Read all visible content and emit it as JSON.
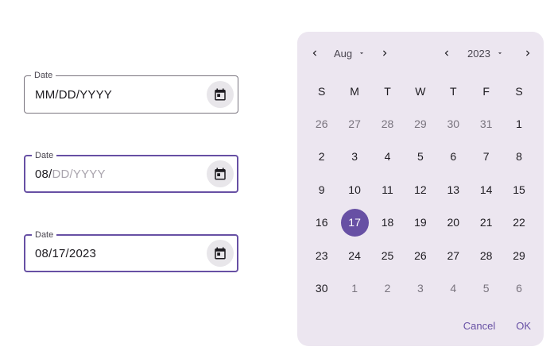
{
  "fields": [
    {
      "label": "Date",
      "typed": "",
      "hint": "MM/DD/YYYY",
      "state": "idle"
    },
    {
      "label": "Date",
      "typed": "08/",
      "hint": "DD/YYYY",
      "state": "focused"
    },
    {
      "label": "Date",
      "typed": "08/17/2023",
      "hint": "",
      "state": "focused"
    }
  ],
  "picker": {
    "month": "Aug",
    "year": "2023",
    "weekdays": [
      "S",
      "M",
      "T",
      "W",
      "T",
      "F",
      "S"
    ],
    "days": [
      {
        "d": "26",
        "outside": true
      },
      {
        "d": "27",
        "outside": true
      },
      {
        "d": "28",
        "outside": true
      },
      {
        "d": "29",
        "outside": true
      },
      {
        "d": "30",
        "outside": true
      },
      {
        "d": "31",
        "outside": true
      },
      {
        "d": "1"
      },
      {
        "d": "2"
      },
      {
        "d": "3"
      },
      {
        "d": "4"
      },
      {
        "d": "5"
      },
      {
        "d": "6"
      },
      {
        "d": "7"
      },
      {
        "d": "8"
      },
      {
        "d": "9"
      },
      {
        "d": "10"
      },
      {
        "d": "11"
      },
      {
        "d": "12"
      },
      {
        "d": "13"
      },
      {
        "d": "14"
      },
      {
        "d": "15"
      },
      {
        "d": "16"
      },
      {
        "d": "17",
        "selected": true
      },
      {
        "d": "18"
      },
      {
        "d": "19"
      },
      {
        "d": "20"
      },
      {
        "d": "21"
      },
      {
        "d": "22"
      },
      {
        "d": "23"
      },
      {
        "d": "24"
      },
      {
        "d": "25"
      },
      {
        "d": "26"
      },
      {
        "d": "27"
      },
      {
        "d": "28"
      },
      {
        "d": "29"
      },
      {
        "d": "30"
      },
      {
        "d": "1",
        "outside": true
      },
      {
        "d": "2",
        "outside": true
      },
      {
        "d": "3",
        "outside": true
      },
      {
        "d": "4",
        "outside": true
      },
      {
        "d": "5",
        "outside": true
      },
      {
        "d": "6",
        "outside": true
      }
    ],
    "cancel_label": "Cancel",
    "ok_label": "OK"
  },
  "colors": {
    "primary": "#6750a4",
    "surface": "#ece6f0",
    "outline": "#79747e"
  },
  "icons": {
    "field_action": "calendar-icon",
    "nav_prev": "chevron-left-icon",
    "nav_next": "chevron-right-icon",
    "dropdown": "caret-down-icon"
  }
}
